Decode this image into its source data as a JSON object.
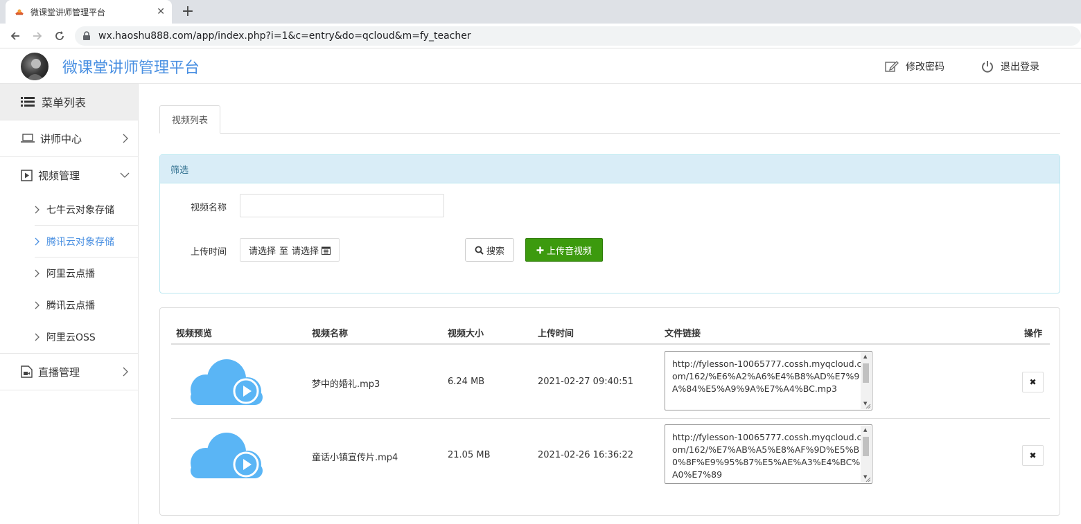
{
  "browser": {
    "tab_title": "微课堂讲师管理平台",
    "url": "wx.haoshu888.com/app/index.php?i=1&c=entry&do=qcloud&m=fy_teacher"
  },
  "header": {
    "brand": "微课堂讲师管理平台",
    "change_password": "修改密码",
    "logout": "退出登录"
  },
  "sidebar": {
    "menu_title": "菜单列表",
    "items": [
      {
        "label": "讲师中心",
        "icon": "laptop-icon",
        "expanded": false
      },
      {
        "label": "视频管理",
        "icon": "play-square-icon",
        "expanded": true
      },
      {
        "label": "直播管理",
        "icon": "video-file-icon",
        "expanded": false
      }
    ],
    "video_subitems": [
      {
        "label": "七牛云对象存储",
        "active": false
      },
      {
        "label": "腾讯云对象存储",
        "active": true
      },
      {
        "label": "阿里云点播",
        "active": false
      },
      {
        "label": "腾讯云点播",
        "active": false
      },
      {
        "label": "阿里云OSS",
        "active": false
      }
    ]
  },
  "content": {
    "tab": "视频列表",
    "filter": {
      "heading": "筛选",
      "name_label": "视频名称",
      "name_value": "",
      "time_label": "上传时间",
      "date_start": "请选择",
      "date_sep": "至",
      "date_end": "请选择",
      "search_button": "搜索",
      "upload_button": "上传音视频"
    },
    "table": {
      "columns": [
        "视频预览",
        "视频名称",
        "视频大小",
        "上传时间",
        "文件链接",
        "操作"
      ],
      "rows": [
        {
          "name": "梦中的婚礼.mp3",
          "size": "6.24 MB",
          "time": "2021-02-27 09:40:51",
          "link": "http://fylesson-10065777.cossh.myqcloud.com/162/%E6%A2%A6%E4%B8%AD%E7%9A%84%E5%A9%9A%E7%A4%BC.mp3"
        },
        {
          "name": "童话小镇宣传片.mp4",
          "size": "21.05 MB",
          "time": "2021-02-26 16:36:22",
          "link": "http://fylesson-10065777.cossh.myqcloud.com/162/%E7%AB%A5%E8%AF%9D%E5%B0%8F%E9%95%87%E5%AE%A3%E4%BC%A0%E7%89"
        }
      ],
      "delete_label": "✖"
    }
  },
  "colors": {
    "accent": "#4a90e2",
    "upload_green": "#3c9a0e",
    "cloud_blue": "#5ab5f5",
    "filter_heading_bg": "#d9edf7"
  }
}
